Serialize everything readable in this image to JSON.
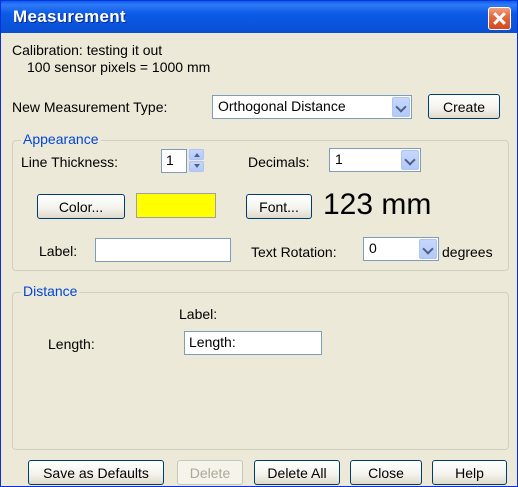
{
  "window": {
    "title": "Measurement"
  },
  "calibration": {
    "line1": "Calibration:  testing it out",
    "line2": "100 sensor pixels = 1000 mm"
  },
  "measurement_type": {
    "label": "New Measurement Type:",
    "value": "Orthogonal Distance",
    "create_label": "Create"
  },
  "appearance": {
    "group_label": "Appearance",
    "line_thickness_label": "Line Thickness:",
    "line_thickness_value": "1",
    "decimals_label": "Decimals:",
    "decimals_value": "1",
    "color_button": "Color...",
    "color_swatch": "#FFFF00",
    "font_button": "Font...",
    "preview_text": "123 mm",
    "label_label": "Label:",
    "label_value": "",
    "text_rotation_label": "Text Rotation:",
    "text_rotation_value": "0",
    "degrees_label": "degrees"
  },
  "distance": {
    "group_label": "Distance",
    "label_header": "Label:",
    "length_label": "Length:",
    "length_value": "Length:"
  },
  "footer": {
    "save_defaults": "Save as Defaults",
    "delete": "Delete",
    "delete_all": "Delete All",
    "close": "Close",
    "help": "Help"
  },
  "colors": {
    "titlebar": "#0A54DD",
    "dialog_bg": "#ECE9D8",
    "group_label": "#0046D5",
    "close_button": "#D24A20"
  }
}
